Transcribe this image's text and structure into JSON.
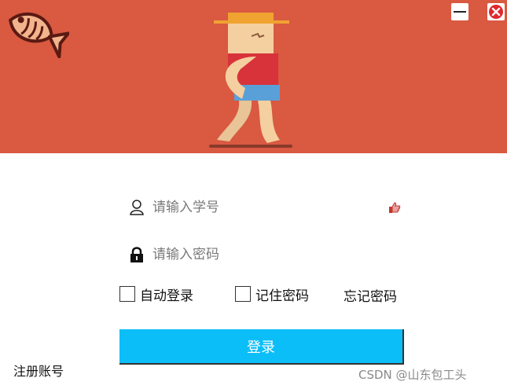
{
  "window": {
    "minimize_icon": "minimize-icon",
    "close_icon": "close-circle-icon"
  },
  "banner": {
    "background": "#d95941",
    "logo_icon": "fish-icon",
    "mascot_icon": "pixel-walking-character"
  },
  "form": {
    "student_id": {
      "placeholder": "请输入学号",
      "value": "",
      "icon": "user-icon",
      "trailing_icon": "thumbs-up-icon"
    },
    "password": {
      "placeholder": "请输入密码",
      "value": "",
      "icon": "lock-icon"
    },
    "auto_login": {
      "label": "自动登录",
      "checked": false
    },
    "remember_password": {
      "label": "记住密码",
      "checked": false
    },
    "forgot_password": "忘记密码",
    "login_button": "登录",
    "login_button_color": "#0cbef8"
  },
  "register_link": "注册账号",
  "watermark": "CSDN @山东包工头"
}
